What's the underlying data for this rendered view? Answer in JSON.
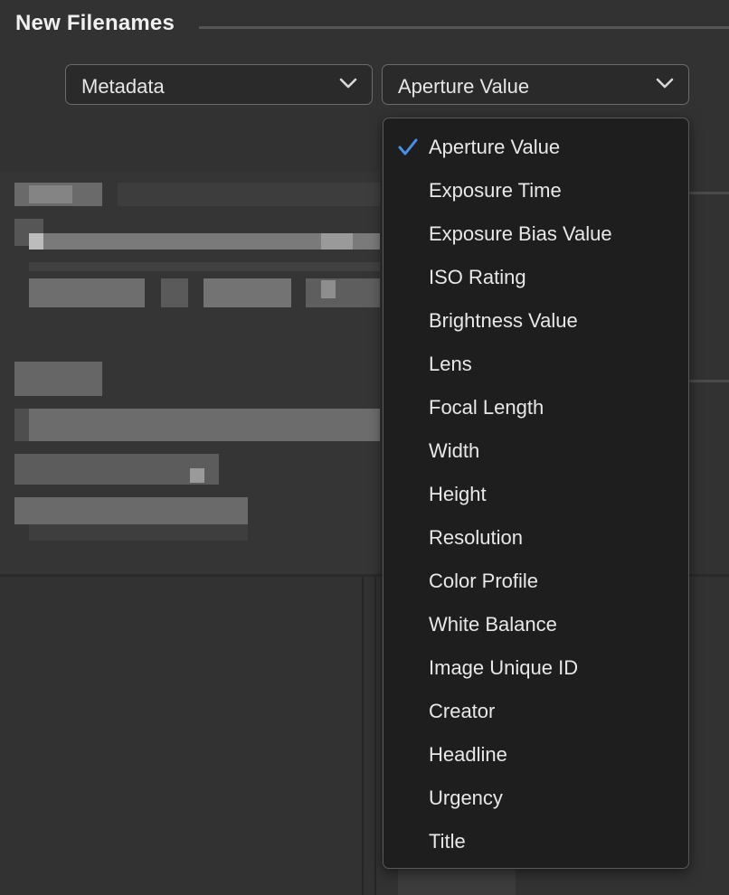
{
  "section": {
    "title": "New Filenames"
  },
  "selects": {
    "first": {
      "value": "Metadata"
    },
    "second": {
      "value": "Aperture Value"
    }
  },
  "menu": {
    "selected": "Aperture Value",
    "items": [
      "Aperture Value",
      "Exposure Time",
      "Exposure Bias Value",
      "ISO Rating",
      "Brightness Value",
      "Lens",
      "Focal Length",
      "Width",
      "Height",
      "Resolution",
      "Color Profile",
      "White Balance",
      "Image Unique ID",
      "Creator",
      "Headline",
      "Urgency",
      "Title"
    ]
  },
  "colors": {
    "checkmark": "#4a8fe7",
    "background": "#323232",
    "menu_background": "#1e1e1e"
  },
  "icons": {
    "select_arrow": "chevron-down-icon",
    "selected_marker": "checkmark-icon"
  }
}
